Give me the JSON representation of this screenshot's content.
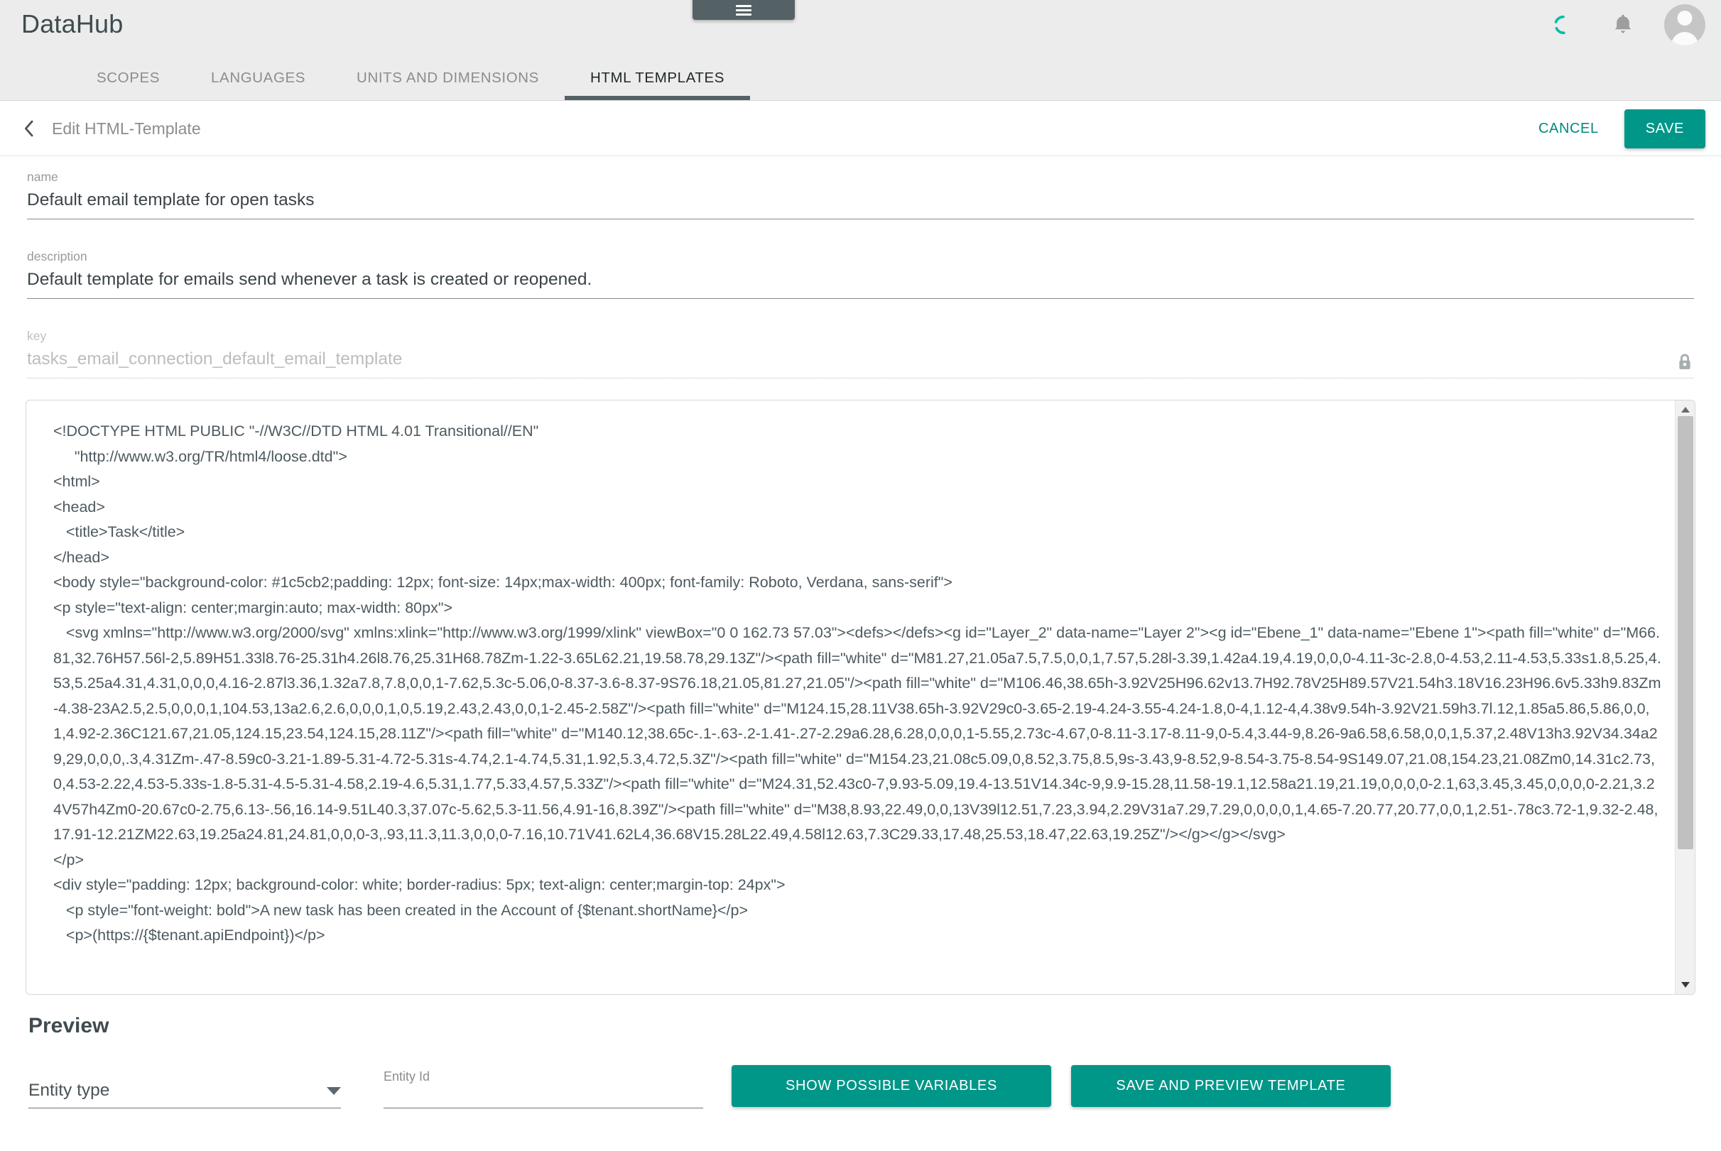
{
  "app": {
    "brand": "DataHub",
    "menu_icon": "hamburger-icon",
    "sync_icon": "sync-spinner-icon",
    "bell_icon": "notifications-bell-icon",
    "avatar_icon": "user-avatar-icon"
  },
  "colors": {
    "accent_teal": "#009688",
    "header_bg": "#ececec",
    "tab_indicator": "#546165",
    "text_dark": "#3f4b50",
    "text_muted": "#8d8d8d",
    "code_text": "#4d5a60"
  },
  "tabs": [
    {
      "label": "SCOPES",
      "active": false
    },
    {
      "label": "LANGUAGES",
      "active": false
    },
    {
      "label": "UNITS AND DIMENSIONS",
      "active": false
    },
    {
      "label": "HTML TEMPLATES",
      "active": true
    }
  ],
  "toolbar": {
    "back_icon": "chevron-left-icon",
    "title": "Edit HTML-Template",
    "cancel_label": "CANCEL",
    "save_label": "SAVE"
  },
  "form": {
    "name": {
      "label": "name",
      "value": "Default email template for open tasks",
      "placeholder": "name"
    },
    "description": {
      "label": "description",
      "value": "Default template for emails send whenever a task is created or reopened.",
      "placeholder": "description"
    },
    "key": {
      "label": "key",
      "value": "tasks_email_connection_default_email_template",
      "placeholder": "key",
      "lock_icon": "lock-icon",
      "readonly": true
    }
  },
  "editor": {
    "scrollbar_up_icon": "scroll-up-arrow-icon",
    "scrollbar_down_icon": "scroll-down-arrow-icon",
    "lines": [
      "<!DOCTYPE HTML PUBLIC \"-//W3C//DTD HTML 4.01 Transitional//EN\"",
      "     \"http://www.w3.org/TR/html4/loose.dtd\">",
      "<html>",
      "<head>",
      "   <title>Task</title>",
      "</head>",
      "<body style=\"background-color: #1c5cb2;padding: 12px; font-size: 14px;max-width: 400px; font-family: Roboto, Verdana, sans-serif\">",
      "<p style=\"text-align: center;margin:auto; max-width: 80px\">",
      "   <svg xmlns=\"http://www.w3.org/2000/svg\" xmlns:xlink=\"http://www.w3.org/1999/xlink\" viewBox=\"0 0 162.73 57.03\"><defs></defs><g id=\"Layer_2\" data-name=\"Layer 2\"><g id=\"Ebene_1\" data-name=\"Ebene 1\"><path fill=\"white\" d=\"M66.81,32.76H57.56l-2,5.89H51.33l8.76-25.31h4.26l8.76,25.31H68.78Zm-1.22-3.65L62.21,19.58.78,29.13Z\"/><path fill=\"white\" d=\"M81.27,21.05a7.5,7.5,0,0,1,7.57,5.28l-3.39,1.42a4.19,4.19,0,0,0-4.11-3c-2.8,0-4.53,2.11-4.53,5.33s1.8,5.25,4.53,5.25a4.31,4.31,0,0,0,4.16-2.87l3.36,1.32a7.8,7.8,0,0,1-7.62,5.3c-5.06,0-8.37-3.6-8.37-9S76.18,21.05,81.27,21.05\"/><path fill=\"white\" d=\"M106.46,38.65h-3.92V25H96.62v13.7H92.78V25H89.57V21.54h3.18V16.23H96.6v5.33h9.83Zm-4.38-23A2.5,2.5,0,0,0,1,104.53,13a2.6,2.6,0,0,0,1,0,5.19,2.43,2.43,0,0,1-2.45-2.58Z\"/><path fill=\"white\" d=\"M124.15,28.11V38.65h-3.92V29c0-3.65-2.19-4.24-3.55-4.24-1.8,0-4,1.12-4,4.38v9.54h-3.92V21.59h3.7l.12,1.85a5.86,5.86,0,0,1,4.92-2.36C121.67,21.05,124.15,23.54,124.15,28.11Z\"/><path fill=\"white\" d=\"M140.12,38.65c-.1-.63-.2-1.41-.27-2.29a6.28,6.28,0,0,0,1-5.55,2.73c-4.67,0-8.11-3.17-8.11-9,0-5.4,3.44-9,8.26-9a6.58,6.58,0,0,1,5.37,2.48V13h3.92V34.34a29,29,0,0,0,.3,4.31Zm-.47-8.59c0-3.21-1.89-5.31-4.72-5.31s-4.74,2.1-4.74,5.31,1.92,5.3,4.72,5.3Z\"/><path fill=\"white\" d=\"M154.23,21.08c5.09,0,8.52,3.75,8.5,9s-3.43,9-8.52,9-8.54-3.75-8.54-9S149.07,21.08,154.23,21.08Zm0,14.31c2.73,0,4.53-2.22,4.53-5.33s-1.8-5.31-4.5-5.31-4.58,2.19-4.6,5.31,1.77,5.33,4.57,5.33Z\"/><path fill=\"white\" d=\"M24.31,52.43c0-7,9.93-5.09,19.4-13.51V14.34c-9,9.9-15.28,11.58-19.1,12.58a21.19,21.19,0,0,0,0-2.1,63,3.45,3.45,0,0,0,0-2.21,3.24V57h4Zm0-20.67c0-2.75,6.13-.56,16.14-9.51L40.3,37.07c-5.62,5.3-11.56,4.91-16,8.39Z\"/><path fill=\"white\" d=\"M38,8.93,22.49,0,0,13V39l12.51,7.23,3.94,2.29V31a7.29,7.29,0,0,0,0,1,4.65-7.20.77,20.77,0,0,1,2.51-.78c3.72-1,9.32-2.48,17.91-12.21ZM22.63,19.25a24.81,24.81,0,0,0-3,.93,11.3,11.3,0,0,0-7.16,10.71V41.62L4,36.68V15.28L22.49,4.58l12.63,7.3C29.33,17.48,25.53,18.47,22.63,19.25Z\"/></g></g></svg>",
      "</p>",
      "<div style=\"padding: 12px; background-color: white; border-radius: 5px; text-align: center;margin-top: 24px\">",
      "   <p style=\"font-weight: bold\">A new task has been created in the Account of {$tenant.shortName}</p>",
      "   <p>(https://{$tenant.apiEndpoint})</p>"
    ]
  },
  "preview": {
    "title": "Preview",
    "entity_type": {
      "label": "Entity type",
      "value": "Entity type",
      "caret_icon": "chevron-down-icon"
    },
    "entity_id": {
      "label": "Entity Id",
      "value": "",
      "placeholder": ""
    },
    "show_variables_label": "SHOW POSSIBLE VARIABLES",
    "save_preview_label": "SAVE AND PREVIEW TEMPLATE"
  }
}
